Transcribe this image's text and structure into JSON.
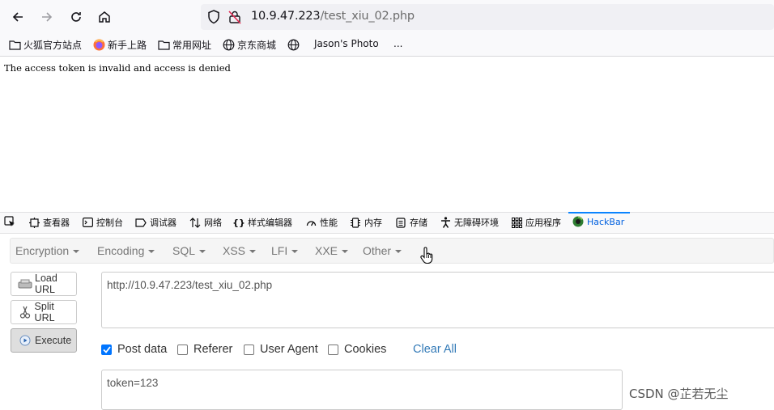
{
  "browser": {
    "url_host": "10.9.47.223",
    "url_path": "/test_xiu_02.php"
  },
  "bookmarks": [
    {
      "label": "火狐官方站点",
      "icon": "folder-icon"
    },
    {
      "label": "新手上路",
      "icon": "firefox-icon"
    },
    {
      "label": "常用网址",
      "icon": "folder-icon"
    },
    {
      "label": "京东商城",
      "icon": "globe-icon"
    },
    {
      "label": "",
      "icon": "globe-icon"
    },
    {
      "label": "Jason's Photo",
      "icon": ""
    },
    {
      "label": "...",
      "icon": ""
    }
  ],
  "page": {
    "message": "The access token is invalid and access is denied"
  },
  "devtools": {
    "tabs": [
      {
        "label": "查看器",
        "icon": "inspector-icon"
      },
      {
        "label": "控制台",
        "icon": "console-icon"
      },
      {
        "label": "调试器",
        "icon": "debugger-icon"
      },
      {
        "label": "网络",
        "icon": "network-icon"
      },
      {
        "label": "样式编辑器",
        "icon": "style-editor-icon"
      },
      {
        "label": "性能",
        "icon": "performance-icon"
      },
      {
        "label": "内存",
        "icon": "memory-icon"
      },
      {
        "label": "存储",
        "icon": "storage-icon"
      },
      {
        "label": "无障碍环境",
        "icon": "accessibility-icon"
      },
      {
        "label": "应用程序",
        "icon": "application-icon"
      },
      {
        "label": "HackBar",
        "icon": "hackbar-icon",
        "active": true
      }
    ]
  },
  "hackbar": {
    "menu": [
      "Encryption",
      "Encoding",
      "SQL",
      "XSS",
      "LFI",
      "XXE",
      "Other"
    ],
    "load_url": "Load URL",
    "split_url": "Split URL",
    "execute": "Execute",
    "url_value": "http://10.9.47.223/test_xiu_02.php",
    "options": [
      {
        "label": "Post data",
        "checked": true
      },
      {
        "label": "Referer",
        "checked": false
      },
      {
        "label": "User Agent",
        "checked": false
      },
      {
        "label": "Cookies",
        "checked": false
      }
    ],
    "clear_all": "Clear All",
    "post_value": "token=123"
  },
  "watermark": "CSDN @芷若无尘",
  "colors": {
    "accent": "#0a84ff",
    "link": "#337ab7",
    "checkbox": "#0075ff"
  }
}
